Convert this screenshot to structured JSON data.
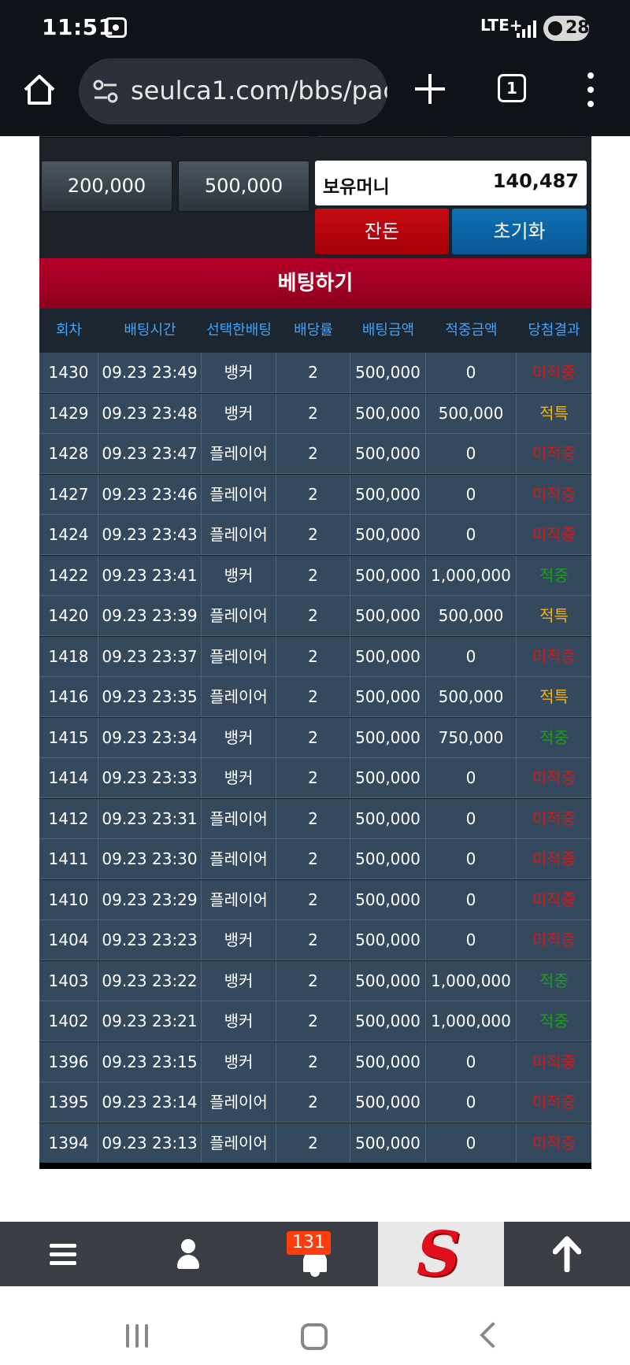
{
  "status_bar": {
    "time": "11:51",
    "network": "LTE+",
    "battery": "28"
  },
  "browser": {
    "url": "seulca1.com/bbs/pag",
    "tab_count": "1"
  },
  "amounts": [
    "200,000",
    "500,000"
  ],
  "money": {
    "label": "보유머니",
    "value": "140,487"
  },
  "buttons": {
    "change": "잔돈",
    "reset": "초기화"
  },
  "bet_header": "베팅하기",
  "table": {
    "columns": [
      "회차",
      "배팅시간",
      "선택한배팅",
      "배당률",
      "배팅금액",
      "적중금액",
      "당첨결과"
    ],
    "rows": [
      {
        "round": "1430",
        "time": "09.23 23:49",
        "pick": "뱅커",
        "odds": "2",
        "bet": "500,000",
        "win": "0",
        "result": "미적중",
        "status": "lose"
      },
      {
        "round": "1429",
        "time": "09.23 23:48",
        "pick": "뱅커",
        "odds": "2",
        "bet": "500,000",
        "win": "500,000",
        "result": "적특",
        "status": "tie"
      },
      {
        "round": "1428",
        "time": "09.23 23:47",
        "pick": "플레이어",
        "odds": "2",
        "bet": "500,000",
        "win": "0",
        "result": "미적중",
        "status": "lose"
      },
      {
        "round": "1427",
        "time": "09.23 23:46",
        "pick": "플레이어",
        "odds": "2",
        "bet": "500,000",
        "win": "0",
        "result": "미적중",
        "status": "lose"
      },
      {
        "round": "1424",
        "time": "09.23 23:43",
        "pick": "플레이어",
        "odds": "2",
        "bet": "500,000",
        "win": "0",
        "result": "미적중",
        "status": "lose"
      },
      {
        "round": "1422",
        "time": "09.23 23:41",
        "pick": "뱅커",
        "odds": "2",
        "bet": "500,000",
        "win": "1,000,000",
        "result": "적중",
        "status": "win"
      },
      {
        "round": "1420",
        "time": "09.23 23:39",
        "pick": "플레이어",
        "odds": "2",
        "bet": "500,000",
        "win": "500,000",
        "result": "적특",
        "status": "tie"
      },
      {
        "round": "1418",
        "time": "09.23 23:37",
        "pick": "플레이어",
        "odds": "2",
        "bet": "500,000",
        "win": "0",
        "result": "미적중",
        "status": "lose"
      },
      {
        "round": "1416",
        "time": "09.23 23:35",
        "pick": "플레이어",
        "odds": "2",
        "bet": "500,000",
        "win": "500,000",
        "result": "적특",
        "status": "tie"
      },
      {
        "round": "1415",
        "time": "09.23 23:34",
        "pick": "뱅커",
        "odds": "2",
        "bet": "500,000",
        "win": "750,000",
        "result": "적중",
        "status": "win"
      },
      {
        "round": "1414",
        "time": "09.23 23:33",
        "pick": "뱅커",
        "odds": "2",
        "bet": "500,000",
        "win": "0",
        "result": "미적중",
        "status": "lose"
      },
      {
        "round": "1412",
        "time": "09.23 23:31",
        "pick": "플레이어",
        "odds": "2",
        "bet": "500,000",
        "win": "0",
        "result": "미적중",
        "status": "lose"
      },
      {
        "round": "1411",
        "time": "09.23 23:30",
        "pick": "플레이어",
        "odds": "2",
        "bet": "500,000",
        "win": "0",
        "result": "미적중",
        "status": "lose"
      },
      {
        "round": "1410",
        "time": "09.23 23:29",
        "pick": "플레이어",
        "odds": "2",
        "bet": "500,000",
        "win": "0",
        "result": "미적중",
        "status": "lose"
      },
      {
        "round": "1404",
        "time": "09.23 23:23",
        "pick": "뱅커",
        "odds": "2",
        "bet": "500,000",
        "win": "0",
        "result": "미적중",
        "status": "lose"
      },
      {
        "round": "1403",
        "time": "09.23 23:22",
        "pick": "뱅커",
        "odds": "2",
        "bet": "500,000",
        "win": "1,000,000",
        "result": "적중",
        "status": "win"
      },
      {
        "round": "1402",
        "time": "09.23 23:21",
        "pick": "뱅커",
        "odds": "2",
        "bet": "500,000",
        "win": "1,000,000",
        "result": "적중",
        "status": "win"
      },
      {
        "round": "1396",
        "time": "09.23 23:15",
        "pick": "뱅커",
        "odds": "2",
        "bet": "500,000",
        "win": "0",
        "result": "미적중",
        "status": "lose"
      },
      {
        "round": "1395",
        "time": "09.23 23:14",
        "pick": "플레이어",
        "odds": "2",
        "bet": "500,000",
        "win": "0",
        "result": "미적중",
        "status": "lose"
      },
      {
        "round": "1394",
        "time": "09.23 23:13",
        "pick": "플레이어",
        "odds": "2",
        "bet": "500,000",
        "win": "0",
        "result": "미적중",
        "status": "lose"
      }
    ]
  },
  "bottom_nav": {
    "notification_count": "131"
  },
  "colors": {
    "lose": "#d21919",
    "tie": "#f2b216",
    "win": "#1e9a1e",
    "header_red": "#a50022",
    "accent_blue": "#3ca5ff"
  },
  "icons": [
    "home-icon",
    "tune-icon",
    "plus-icon",
    "tabs-icon",
    "more-vert-icon",
    "menu-icon",
    "person-icon",
    "bell-icon",
    "site-logo-icon",
    "arrow-up-icon"
  ]
}
